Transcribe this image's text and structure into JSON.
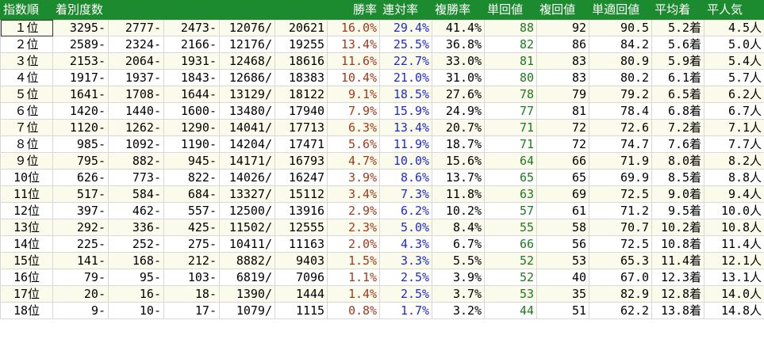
{
  "headers": {
    "rank": "指数順",
    "dist": "着別度数",
    "win": "勝率",
    "rentai": "連対率",
    "fukusho": "複勝率",
    "tanshou_ret": "単回値",
    "fukushou_ret": "複回値",
    "tan_tekisei": "単適回値",
    "avg_finish": "平均着",
    "avg_pop": "平人気"
  },
  "colors": {
    "header_bg": "#1c8a2e",
    "win_text": "#a23a1a",
    "rentai_text": "#1f2acc",
    "tanshou_text": "#1d7a1d"
  },
  "rows": [
    {
      "rank": "１位",
      "d1": "3295-",
      "d2": "2777-",
      "d3": "2473-",
      "d4": "12076/",
      "total": "20621",
      "win": "16.0%",
      "rentai": "29.4%",
      "fukusho": "41.4%",
      "tan": "88",
      "fuku": "92",
      "tekisei": "90.5",
      "avg_finish": "5.2着",
      "avg_pop": "4.5人"
    },
    {
      "rank": "２位",
      "d1": "2589-",
      "d2": "2324-",
      "d3": "2166-",
      "d4": "12176/",
      "total": "19255",
      "win": "13.4%",
      "rentai": "25.5%",
      "fukusho": "36.8%",
      "tan": "82",
      "fuku": "86",
      "tekisei": "84.2",
      "avg_finish": "5.6着",
      "avg_pop": "5.0人"
    },
    {
      "rank": "３位",
      "d1": "2153-",
      "d2": "2064-",
      "d3": "1931-",
      "d4": "12468/",
      "total": "18616",
      "win": "11.6%",
      "rentai": "22.7%",
      "fukusho": "33.0%",
      "tan": "81",
      "fuku": "83",
      "tekisei": "80.9",
      "avg_finish": "5.9着",
      "avg_pop": "5.4人"
    },
    {
      "rank": "４位",
      "d1": "1917-",
      "d2": "1937-",
      "d3": "1843-",
      "d4": "12686/",
      "total": "18383",
      "win": "10.4%",
      "rentai": "21.0%",
      "fukusho": "31.0%",
      "tan": "80",
      "fuku": "83",
      "tekisei": "80.2",
      "avg_finish": "6.1着",
      "avg_pop": "5.7人"
    },
    {
      "rank": "５位",
      "d1": "1641-",
      "d2": "1708-",
      "d3": "1644-",
      "d4": "13129/",
      "total": "18122",
      "win": "9.1%",
      "rentai": "18.5%",
      "fukusho": "27.6%",
      "tan": "78",
      "fuku": "79",
      "tekisei": "79.2",
      "avg_finish": "6.5着",
      "avg_pop": "6.2人"
    },
    {
      "rank": "６位",
      "d1": "1420-",
      "d2": "1440-",
      "d3": "1600-",
      "d4": "13480/",
      "total": "17940",
      "win": "7.9%",
      "rentai": "15.9%",
      "fukusho": "24.9%",
      "tan": "77",
      "fuku": "81",
      "tekisei": "78.4",
      "avg_finish": "6.8着",
      "avg_pop": "6.7人"
    },
    {
      "rank": "７位",
      "d1": "1120-",
      "d2": "1262-",
      "d3": "1290-",
      "d4": "14041/",
      "total": "17713",
      "win": "6.3%",
      "rentai": "13.4%",
      "fukusho": "20.7%",
      "tan": "71",
      "fuku": "72",
      "tekisei": "72.6",
      "avg_finish": "7.2着",
      "avg_pop": "7.1人"
    },
    {
      "rank": "８位",
      "d1": "985-",
      "d2": "1092-",
      "d3": "1190-",
      "d4": "14204/",
      "total": "17471",
      "win": "5.6%",
      "rentai": "11.9%",
      "fukusho": "18.7%",
      "tan": "71",
      "fuku": "72",
      "tekisei": "74.7",
      "avg_finish": "7.6着",
      "avg_pop": "7.7人"
    },
    {
      "rank": "９位",
      "d1": "795-",
      "d2": "882-",
      "d3": "945-",
      "d4": "14171/",
      "total": "16793",
      "win": "4.7%",
      "rentai": "10.0%",
      "fukusho": "15.6%",
      "tan": "64",
      "fuku": "66",
      "tekisei": "71.9",
      "avg_finish": "8.0着",
      "avg_pop": "8.2人"
    },
    {
      "rank": "10位",
      "d1": "626-",
      "d2": "773-",
      "d3": "822-",
      "d4": "14026/",
      "total": "16247",
      "win": "3.9%",
      "rentai": "8.6%",
      "fukusho": "13.7%",
      "tan": "65",
      "fuku": "65",
      "tekisei": "69.9",
      "avg_finish": "8.5着",
      "avg_pop": "8.8人"
    },
    {
      "rank": "11位",
      "d1": "517-",
      "d2": "584-",
      "d3": "684-",
      "d4": "13327/",
      "total": "15112",
      "win": "3.4%",
      "rentai": "7.3%",
      "fukusho": "11.8%",
      "tan": "63",
      "fuku": "69",
      "tekisei": "72.5",
      "avg_finish": "9.0着",
      "avg_pop": "9.4人"
    },
    {
      "rank": "12位",
      "d1": "397-",
      "d2": "462-",
      "d3": "557-",
      "d4": "12500/",
      "total": "13916",
      "win": "2.9%",
      "rentai": "6.2%",
      "fukusho": "10.2%",
      "tan": "57",
      "fuku": "61",
      "tekisei": "71.2",
      "avg_finish": "9.5着",
      "avg_pop": "10.0人"
    },
    {
      "rank": "13位",
      "d1": "292-",
      "d2": "336-",
      "d3": "425-",
      "d4": "11502/",
      "total": "12555",
      "win": "2.3%",
      "rentai": "5.0%",
      "fukusho": "8.4%",
      "tan": "55",
      "fuku": "58",
      "tekisei": "70.7",
      "avg_finish": "10.2着",
      "avg_pop": "10.8人"
    },
    {
      "rank": "14位",
      "d1": "225-",
      "d2": "252-",
      "d3": "275-",
      "d4": "10411/",
      "total": "11163",
      "win": "2.0%",
      "rentai": "4.3%",
      "fukusho": "6.7%",
      "tan": "66",
      "fuku": "56",
      "tekisei": "72.5",
      "avg_finish": "10.8着",
      "avg_pop": "11.4人"
    },
    {
      "rank": "15位",
      "d1": "141-",
      "d2": "168-",
      "d3": "212-",
      "d4": "8882/",
      "total": "9403",
      "win": "1.5%",
      "rentai": "3.3%",
      "fukusho": "5.5%",
      "tan": "52",
      "fuku": "53",
      "tekisei": "65.3",
      "avg_finish": "11.4着",
      "avg_pop": "12.1人"
    },
    {
      "rank": "16位",
      "d1": "79-",
      "d2": "95-",
      "d3": "103-",
      "d4": "6819/",
      "total": "7096",
      "win": "1.1%",
      "rentai": "2.5%",
      "fukusho": "3.9%",
      "tan": "52",
      "fuku": "40",
      "tekisei": "67.0",
      "avg_finish": "12.3着",
      "avg_pop": "13.1人"
    },
    {
      "rank": "17位",
      "d1": "20-",
      "d2": "16-",
      "d3": "18-",
      "d4": "1390/",
      "total": "1444",
      "win": "1.4%",
      "rentai": "2.5%",
      "fukusho": "3.7%",
      "tan": "53",
      "fuku": "35",
      "tekisei": "82.9",
      "avg_finish": "12.8着",
      "avg_pop": "14.0人"
    },
    {
      "rank": "18位",
      "d1": "9-",
      "d2": "10-",
      "d3": "17-",
      "d4": "1079/",
      "total": "1115",
      "win": "0.8%",
      "rentai": "1.7%",
      "fukusho": "3.2%",
      "tan": "44",
      "fuku": "51",
      "tekisei": "62.2",
      "avg_finish": "13.8着",
      "avg_pop": "14.8人"
    }
  ]
}
